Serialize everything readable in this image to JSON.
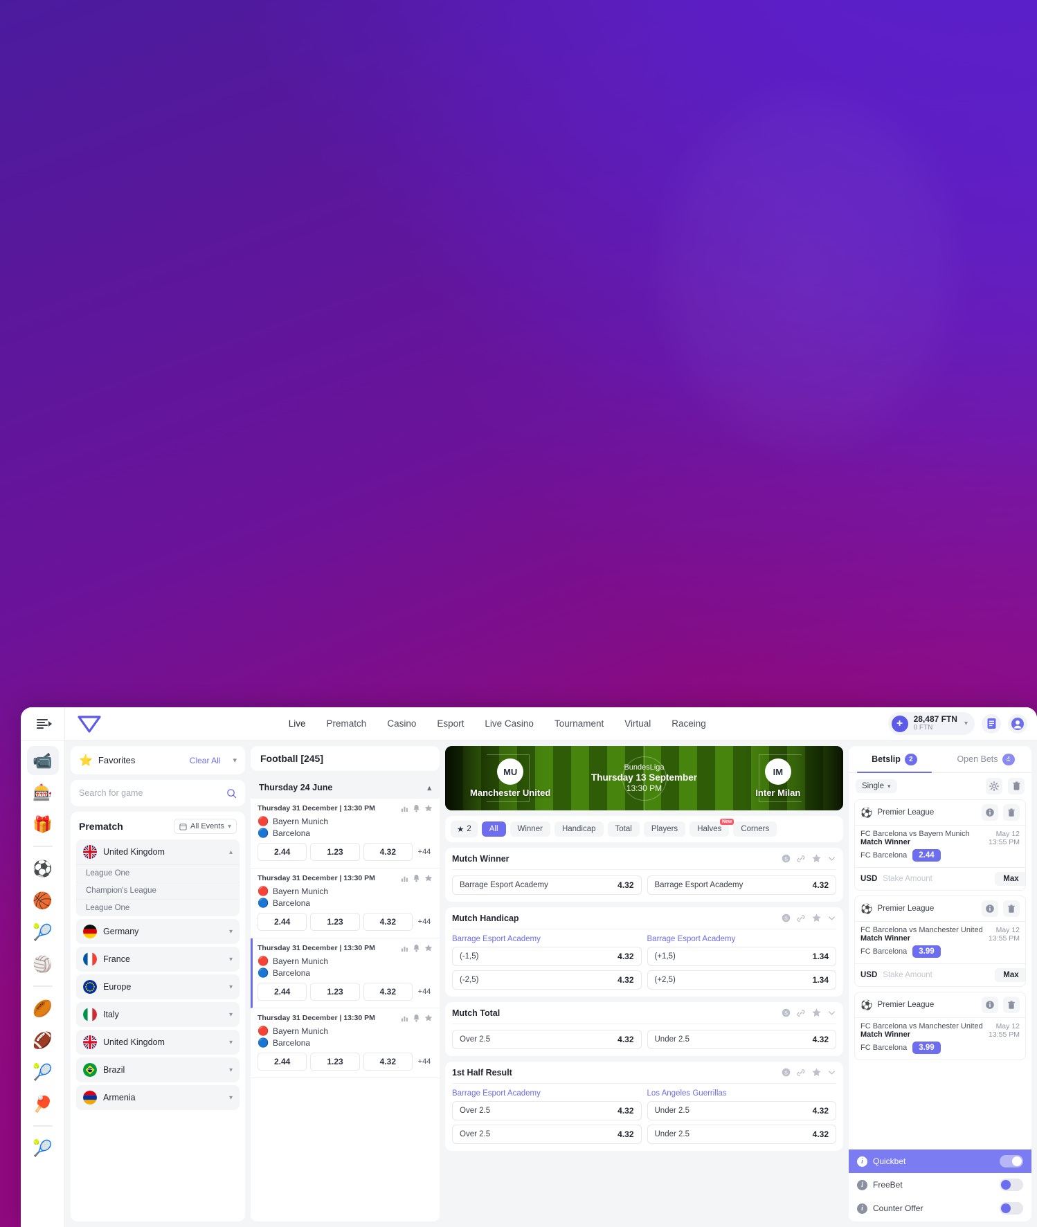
{
  "rail": {
    "menu_icon": "hamburger-collapse-icon",
    "items": [
      {
        "name": "live-stream",
        "glyph": "📹",
        "active": true
      },
      {
        "name": "slots",
        "glyph": "🎰",
        "active": false
      },
      {
        "name": "gifts",
        "glyph": "🎁",
        "active": false
      },
      {
        "name": "football",
        "glyph": "⚽",
        "active": false
      },
      {
        "name": "basketball",
        "glyph": "🏀",
        "active": false
      },
      {
        "name": "tennis",
        "glyph": "🎾",
        "active": false
      },
      {
        "name": "volleyball",
        "glyph": "🏐",
        "active": false
      },
      {
        "name": "rugby",
        "glyph": "🏉",
        "active": false
      },
      {
        "name": "american-football",
        "glyph": "🏈",
        "active": false
      },
      {
        "name": "tennis-racket",
        "glyph": "🎾",
        "active": false
      },
      {
        "name": "table-tennis",
        "glyph": "🏓",
        "active": false
      },
      {
        "name": "tennis-ball",
        "glyph": "🎾",
        "active": false
      }
    ]
  },
  "topnav": {
    "links": [
      "Live",
      "Prematch",
      "Casino",
      "Esport",
      "Live Casino",
      "Tournament",
      "Virtual",
      "Raceing"
    ],
    "balance_main": "28,487 FTN",
    "balance_bonus": "0 FTN",
    "add_label": "+"
  },
  "sidebar": {
    "favorites_label": "Favorites",
    "clear_all_label": "Clear All",
    "search_placeholder": "Search for game",
    "search_value": "",
    "prematch_title": "Prematch",
    "all_events_label": "All Events",
    "countries": [
      {
        "name": "United Kingdom",
        "flag": "uk",
        "expanded": true,
        "leagues": [
          "League One",
          "Champion's League",
          "League One"
        ]
      },
      {
        "name": "Germany",
        "flag": "de",
        "expanded": false,
        "leagues": []
      },
      {
        "name": "France",
        "flag": "fr",
        "expanded": false,
        "leagues": []
      },
      {
        "name": "Europe",
        "flag": "eu",
        "expanded": false,
        "leagues": []
      },
      {
        "name": "Italy",
        "flag": "it",
        "expanded": false,
        "leagues": []
      },
      {
        "name": "United Kingdom",
        "flag": "uk",
        "expanded": false,
        "leagues": []
      },
      {
        "name": "Brazil",
        "flag": "br",
        "expanded": false,
        "leagues": []
      },
      {
        "name": "Armenia",
        "flag": "am",
        "expanded": false,
        "leagues": []
      }
    ]
  },
  "matchlist": {
    "sport_header": "Football [245]",
    "day_header": "Thursday 24 June",
    "matches": [
      {
        "time": "Thursday 31 December | 13:30 PM",
        "home": "Bayern Munich",
        "away": "Barcelona",
        "odds": [
          "2.44",
          "1.23",
          "4.32"
        ],
        "more": "+44",
        "selected": false
      },
      {
        "time": "Thursday 31 December | 13:30 PM",
        "home": "Bayern Munich",
        "away": "Barcelona",
        "odds": [
          "2.44",
          "1.23",
          "4.32"
        ],
        "more": "+44",
        "selected": false
      },
      {
        "time": "Thursday 31 December | 13:30 PM",
        "home": "Bayern Munich",
        "away": "Barcelona",
        "odds": [
          "2.44",
          "1.23",
          "4.32"
        ],
        "more": "+44",
        "selected": true
      },
      {
        "time": "Thursday 31 December | 13:30 PM",
        "home": "Bayern Munich",
        "away": "Barcelona",
        "odds": [
          "2.44",
          "1.23",
          "4.32"
        ],
        "more": "+44",
        "selected": false
      }
    ]
  },
  "detail": {
    "league": "BundesLiga",
    "date": "Thursday 13 September",
    "time": "13:30 PM",
    "home_team": "Manchester United",
    "home_abbr": "MU",
    "away_team": "Inter Milan",
    "away_abbr": "IM",
    "fav_count": "2",
    "tabs": [
      {
        "label": "All",
        "active": true,
        "badge": null
      },
      {
        "label": "Winner",
        "active": false,
        "badge": null
      },
      {
        "label": "Handicap",
        "active": false,
        "badge": null
      },
      {
        "label": "Total",
        "active": false,
        "badge": null
      },
      {
        "label": "Players",
        "active": false,
        "badge": null
      },
      {
        "label": "Halves",
        "active": false,
        "badge": "New"
      },
      {
        "label": "Corners",
        "active": false,
        "badge": null
      }
    ],
    "markets": [
      {
        "title": "Mutch Winner",
        "subnames": [],
        "rows": [
          [
            {
              "name": "Barrage Esport Academy",
              "odd": "4.32"
            },
            {
              "name": "Barrage Esport Academy",
              "odd": "4.32"
            }
          ]
        ]
      },
      {
        "title": "Mutch Handicap",
        "subnames": [
          "Barrage Esport Academy",
          "Barrage Esport Academy"
        ],
        "rows": [
          [
            {
              "name": "(-1,5)",
              "odd": "4.32"
            },
            {
              "name": "(+1,5)",
              "odd": "1.34"
            }
          ],
          [
            {
              "name": "(-2,5)",
              "odd": "4.32"
            },
            {
              "name": "(+2,5)",
              "odd": "1.34"
            }
          ]
        ]
      },
      {
        "title": "Mutch Total",
        "subnames": [],
        "rows": [
          [
            {
              "name": "Over 2.5",
              "odd": "4.32"
            },
            {
              "name": "Under 2.5",
              "odd": "4.32"
            }
          ]
        ]
      },
      {
        "title": "1st Half Result",
        "subnames": [
          "Barrage Esport Academy",
          "Los Angeles Guerrillas"
        ],
        "rows": [
          [
            {
              "name": "Over 2.5",
              "odd": "4.32"
            },
            {
              "name": "Under 2.5",
              "odd": "4.32"
            }
          ],
          [
            {
              "name": "Over 2.5",
              "odd": "4.32"
            },
            {
              "name": "Under 2.5",
              "odd": "4.32"
            }
          ]
        ]
      }
    ]
  },
  "betslip": {
    "tab_betslip": "Betslip",
    "tab_betslip_count": "2",
    "tab_openbets": "Open Bets",
    "tab_openbets_count": "4",
    "mode_label": "Single",
    "bets": [
      {
        "league": "Premier League",
        "event": "FC Barcelona vs Bayern Munich",
        "market": "Match Winner",
        "date": "May 12",
        "time": "13:55 PM",
        "pick": "FC Barcelona",
        "odd": "2.44",
        "currency": "USD",
        "stake_placeholder": "Stake Amount",
        "stake_value": "",
        "max_label": "Max",
        "show_stake": true
      },
      {
        "league": "Premier League",
        "event": "FC Barcelona vs Manchester United",
        "market": "Match Winner",
        "date": "May 12",
        "time": "13:55 PM",
        "pick": "FC Barcelona",
        "odd": "3.99",
        "currency": "USD",
        "stake_placeholder": "Stake Amount",
        "stake_value": "",
        "max_label": "Max",
        "show_stake": true
      },
      {
        "league": "Premier League",
        "event": "FC Barcelona vs Manchester United",
        "market": "Match Winner",
        "date": "May 12",
        "time": "13:55 PM",
        "pick": "FC Barcelona",
        "odd": "3.99",
        "currency": "USD",
        "stake_placeholder": "Stake Amount",
        "stake_value": "",
        "max_label": "Max",
        "show_stake": false
      }
    ],
    "toggles": [
      {
        "label": "Quickbet",
        "on": true,
        "highlight": true
      },
      {
        "label": "FreeBet",
        "on": false,
        "highlight": false
      },
      {
        "label": "Counter Offer",
        "on": false,
        "highlight": false
      }
    ]
  },
  "colors": {
    "accent": "#6d6df0",
    "brand_bg_top": "#4b1b9e",
    "brand_bg_bottom": "#93067e"
  }
}
